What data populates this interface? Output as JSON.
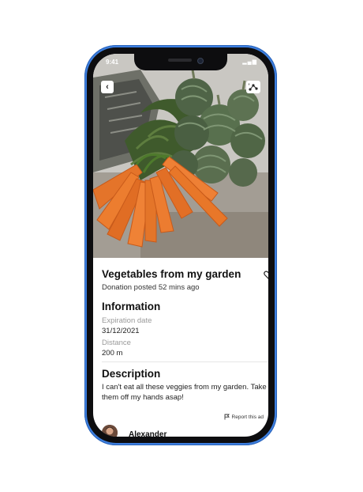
{
  "status_bar": {
    "time": "9:41",
    "icons": "▂▄▆"
  },
  "listing": {
    "title": "Vegetables from my garden",
    "posted": "Donation posted 52 mins ago"
  },
  "information": {
    "heading": "Information",
    "expiration_label": "Expiration date",
    "expiration_value": "31/12/2021",
    "distance_label": "Distance",
    "distance_value": "200 m"
  },
  "description": {
    "heading": "Description",
    "text": "I can't eat all these veggies from my garden. Take them off my hands asap!"
  },
  "report": {
    "label": "Report this ad"
  },
  "user": {
    "name": "Alexander"
  },
  "colors": {
    "frame": "#3d7fe0",
    "carrot": "#e9772c",
    "artichoke": "#5b6e4f"
  },
  "icons": {
    "back": "chevron-left-icon",
    "share": "share-icon",
    "favorite": "heart-icon",
    "report": "flag-icon"
  }
}
